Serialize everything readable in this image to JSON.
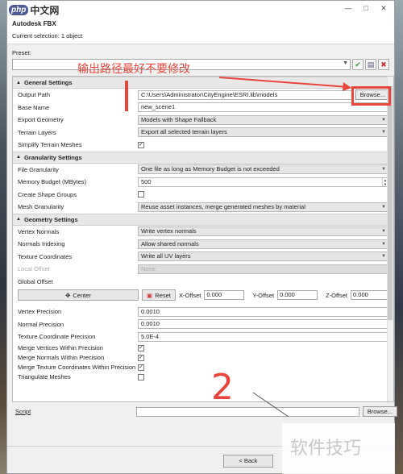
{
  "logo": {
    "php": "php",
    "cn": "中文网"
  },
  "window": {
    "title": "Autodesk FBX",
    "subtitle": "Current selection: 1 object"
  },
  "preset": {
    "label": "Preset:",
    "value": ""
  },
  "annotations": {
    "top": "输出路径最好不要修改",
    "number": "2"
  },
  "general": {
    "header": "General Settings",
    "output_path": {
      "label": "Output Path",
      "value": "C:\\Users\\Administrator\\CityEngine\\ESRI.lib\\models",
      "button": "Browse..."
    },
    "base_name": {
      "label": "Base Name",
      "value": "new_scene1"
    },
    "export_geometry": {
      "label": "Export Geometry",
      "value": "Models with Shape Fallback"
    },
    "terrain_layers": {
      "label": "Terrain Layers",
      "value": "Export all selected terrain layers"
    },
    "simplify": {
      "label": "Simplify Terrain Meshes",
      "checked": "✓"
    }
  },
  "granularity": {
    "header": "Granularity Settings",
    "file_gran": {
      "label": "File Granularity",
      "value": "One file as long as Memory Budget is not exceeded"
    },
    "memory": {
      "label": "Memory Budget (MBytes)",
      "value": "500"
    },
    "shape_groups": {
      "label": "Create Shape Groups"
    },
    "mesh_gran": {
      "label": "Mesh Granularity",
      "value": "Reuse asset instances, merge generated meshes by material"
    }
  },
  "geometry": {
    "header": "Geometry Settings",
    "vertex_normals": {
      "label": "Vertex Normals",
      "value": "Write vertex normals"
    },
    "normals_indexing": {
      "label": "Normals Indexing",
      "value": "Allow shared normals"
    },
    "texture_coords": {
      "label": "Texture Coordinates",
      "value": "Write all UV layers"
    },
    "local_offset": {
      "label": "Local Offset",
      "value": "None"
    },
    "global_offset": {
      "label": "Global Offset"
    },
    "center_btn": "Center",
    "reset_btn": "Reset",
    "x_offset": {
      "label": "X-Offset",
      "value": "0.000"
    },
    "y_offset": {
      "label": "Y-Offset",
      "value": "0.000"
    },
    "z_offset": {
      "label": "Z-Offset",
      "value": "0.000"
    },
    "vertex_precision": {
      "label": "Vertex Precision",
      "value": "0.0010"
    },
    "normal_precision": {
      "label": "Normal Precision",
      "value": "0.0010"
    },
    "texcoord_precision": {
      "label": "Texture Coordinate Precision",
      "value": "5.0E-4"
    },
    "merge_vertices": {
      "label": "Merge Vertices Within Precision",
      "checked": "✓"
    },
    "merge_normals": {
      "label": "Merge Normals Within Precision",
      "checked": "✓"
    },
    "merge_texcoords": {
      "label": "Merge Texture Coordinates Within Precision",
      "checked": "✓"
    },
    "triangulate": {
      "label": "Triangulate Meshes"
    }
  },
  "script": {
    "label": "Script",
    "value": "",
    "button": "Browse..."
  },
  "footer": {
    "back": "< Back"
  },
  "watermark": "软件技巧"
}
